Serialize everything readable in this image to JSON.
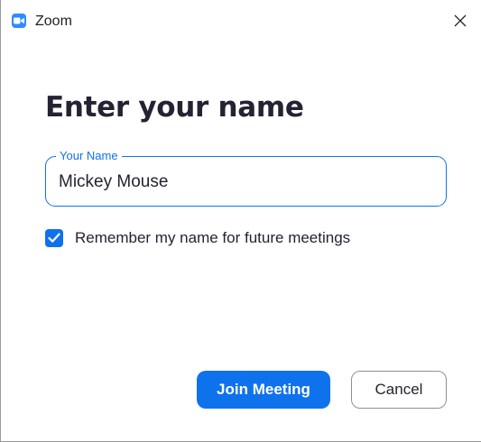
{
  "window": {
    "title": "Zoom",
    "app_icon": "zoom-video-camera-icon",
    "close_icon": "close-icon"
  },
  "dialog": {
    "heading": "Enter your name",
    "name_field": {
      "label": "Your Name",
      "value": "Mickey Mouse"
    },
    "remember": {
      "label": "Remember my name for future meetings",
      "checked": true
    },
    "join_label": "Join Meeting",
    "cancel_label": "Cancel"
  },
  "colors": {
    "accent": "#0E72ED",
    "logo": "#2D8CFF",
    "text": "#232333",
    "button_border": "#8F8F9A"
  }
}
